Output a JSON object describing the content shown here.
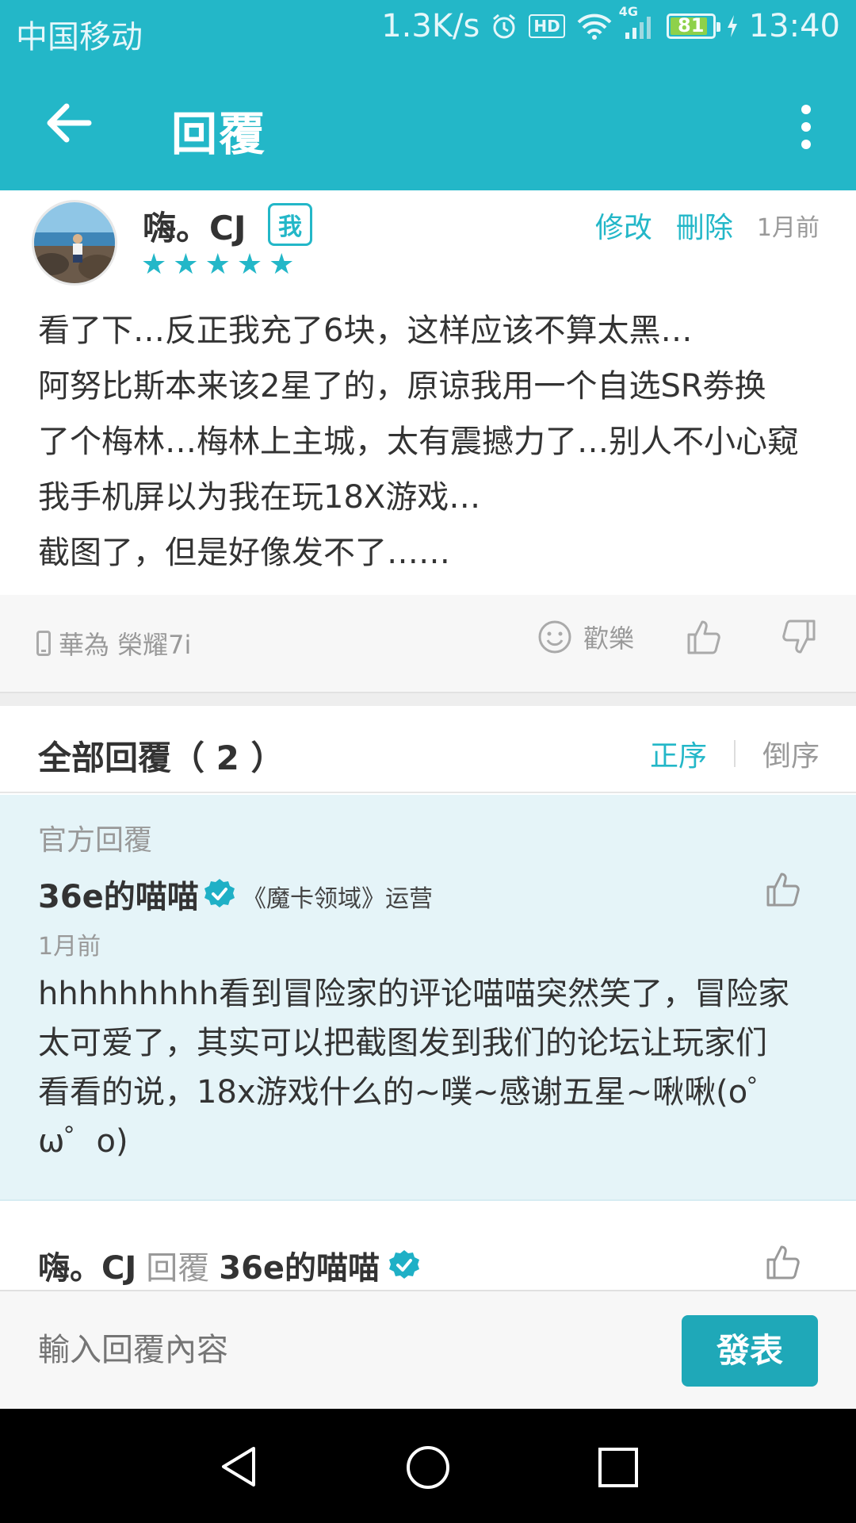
{
  "status_bar": {
    "carrier": "中国移动",
    "speed": "1.3K/s",
    "hd": "HD",
    "network": "4G",
    "battery": "81",
    "time": "13:40"
  },
  "app_bar": {
    "title": "回覆"
  },
  "post": {
    "author": "嗨。CJ",
    "me_badge": "我",
    "rating": 5,
    "edit_label": "修改",
    "delete_label": "刪除",
    "time": "1月前",
    "body_lines": [
      "看了下…反正我充了6块，这样应该不算太黑…",
      "阿努比斯本来该2星了的，原谅我用一个自选SR劵换",
      "了个梅林…梅林上主城，太有震撼力了…别人不小心窥",
      "我手机屏以为我在玩18X游戏…",
      "截图了，但是好像发不了……"
    ],
    "device": "華為 榮耀7i",
    "mood": "歡樂"
  },
  "replies_header": {
    "label": "全部回覆（ 2 ）",
    "sort_asc": "正序",
    "sort_desc": "倒序"
  },
  "official_reply": {
    "tag": "官方回覆",
    "name": "36e的喵喵",
    "role": "《魔卡领域》运营",
    "time": "1月前",
    "body_lines": [
      "hhhhhhhhh看到冒险家的评论喵喵突然笑了，冒险家",
      "太可爱了，其实可以把截图发到我们的论坛让玩家们",
      "看看的说，18x游戏什么的~噗~感谢五星~啾啾(o゜",
      "ω゜o)"
    ]
  },
  "reply": {
    "from": "嗨。CJ",
    "verb": "回覆",
    "to": "36e的喵喵"
  },
  "input_bar": {
    "placeholder": "輸入回覆內容",
    "send_label": "發表"
  },
  "colors": {
    "accent": "#23b7c8",
    "official_bg": "#e5f4f8",
    "send_button": "#1fa8b8"
  }
}
